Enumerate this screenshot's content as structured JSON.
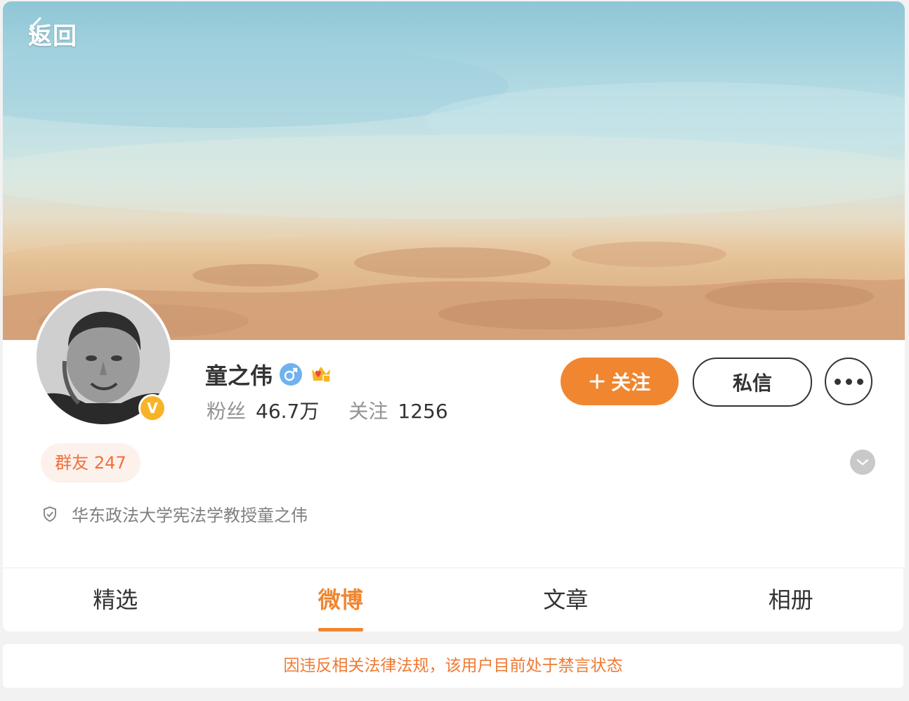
{
  "header": {
    "back_label": "返回"
  },
  "profile": {
    "name": "童之伟",
    "verified_mark": "V",
    "gender_icon": "male-icon",
    "stats": {
      "fans_label": "粉丝",
      "fans_value": "46.7万",
      "following_label": "关注",
      "following_value": "1256"
    },
    "group_badge": "群友 247",
    "certification": "华东政法大学宪法学教授童之伟"
  },
  "actions": {
    "follow_label": "关注",
    "message_label": "私信"
  },
  "tabs": [
    {
      "label": "精选",
      "active": false
    },
    {
      "label": "微博",
      "active": true
    },
    {
      "label": "文章",
      "active": false
    },
    {
      "label": "相册",
      "active": false
    }
  ],
  "notice": "因违反相关法律法规，该用户目前处于禁言状态",
  "colors": {
    "accent": "#f0862f",
    "verified": "#f7b426",
    "gender": "#6fb2ef",
    "badge_text": "#f0703a"
  }
}
